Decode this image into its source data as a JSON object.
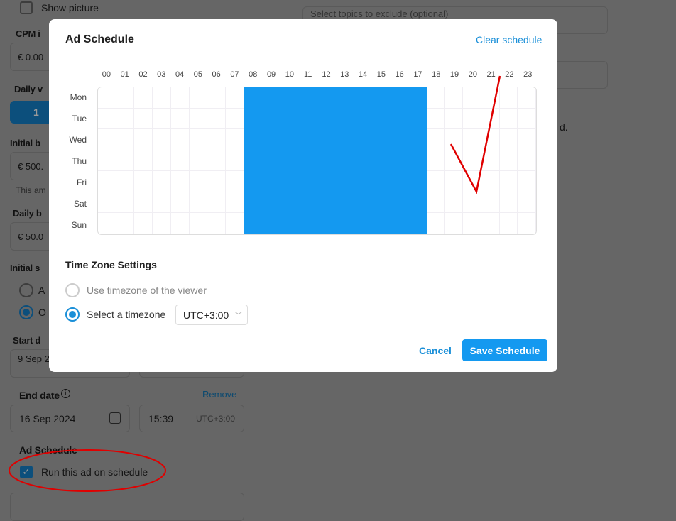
{
  "background": {
    "show_picture": "Show picture",
    "cpm_label": "CPM i",
    "cpm_value": "€  0.00",
    "daily_views_label": "Daily v",
    "daily_views_button": "1",
    "initial_budget_label": "Initial b",
    "initial_budget_value": "€  500.",
    "initial_budget_hint": "This am",
    "daily_budget_label": "Daily b",
    "daily_budget_value": "€  50.0",
    "initial_status_label": "Initial s",
    "radio_a": "A",
    "radio_o": "O",
    "start_date_label": "Start d",
    "start_date_value": "9 Sep 2",
    "end_date_label": "End date",
    "remove_link": "Remove",
    "end_date_value": "16 Sep 2024",
    "end_time_value": "15:39",
    "end_time_tz": "UTC+3:00",
    "ad_schedule_label": "Ad Schedule",
    "run_on_schedule": "Run this ad on schedule",
    "topics_placeholder": "Select topics to exclude (optional)",
    "right_text_fragment": "d."
  },
  "modal": {
    "title": "Ad Schedule",
    "clear_schedule": "Clear schedule",
    "hours": [
      "00",
      "01",
      "02",
      "03",
      "04",
      "05",
      "06",
      "07",
      "08",
      "09",
      "10",
      "11",
      "12",
      "13",
      "14",
      "15",
      "16",
      "17",
      "18",
      "19",
      "20",
      "21",
      "22",
      "23"
    ],
    "days": [
      "Mon",
      "Tue",
      "Wed",
      "Thu",
      "Fri",
      "Sat",
      "Sun"
    ],
    "selected_hours": [
      8,
      9,
      10,
      11,
      12,
      13,
      14,
      15,
      16,
      17
    ],
    "selected_days": [
      "Mon",
      "Tue",
      "Wed",
      "Thu",
      "Fri",
      "Sat",
      "Sun"
    ],
    "timezone_settings": "Time Zone Settings",
    "option_viewer": "Use timezone of the viewer",
    "option_select": "Select a timezone",
    "selected_option": "select",
    "timezone_value": "UTC+3:00",
    "cancel": "Cancel",
    "save": "Save Schedule"
  },
  "colors": {
    "accent": "#1499f0",
    "annotation": "#e00000"
  }
}
